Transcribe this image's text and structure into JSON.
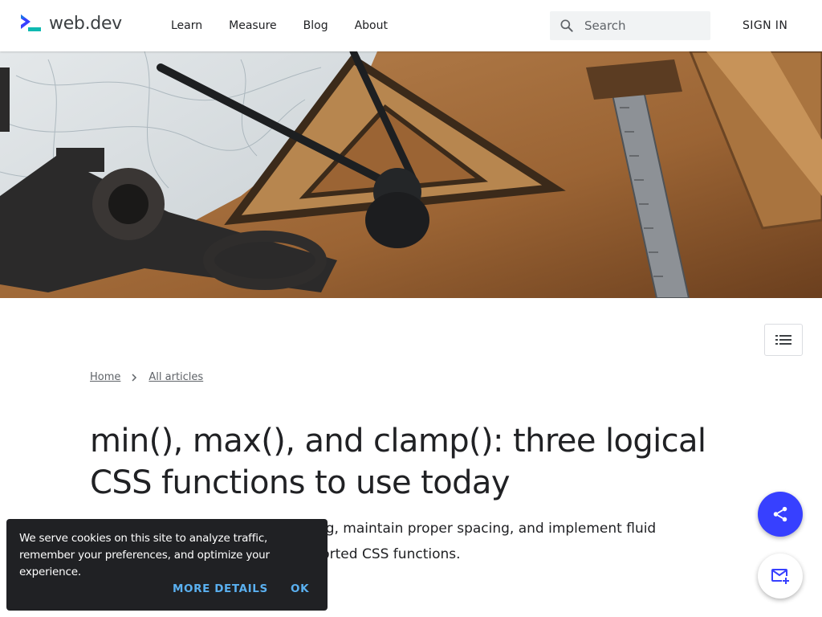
{
  "header": {
    "logo_text": "web.dev",
    "nav": [
      {
        "label": "Learn"
      },
      {
        "label": "Measure"
      },
      {
        "label": "Blog"
      },
      {
        "label": "About"
      }
    ],
    "search_placeholder": "Search",
    "signin_label": "SIGN IN"
  },
  "breadcrumb": {
    "home": "Home",
    "all_articles": "All articles"
  },
  "article": {
    "title": "min(), max(), and clamp(): three logical CSS functions to use today",
    "subtitle": "Learn how to control element sizing, maintain proper spacing, and implement fluid typography using these well-supported CSS functions."
  },
  "cookie_banner": {
    "text": "We serve cookies on this site to analyze traffic, remember your preferences, and optimize your experience.",
    "more_details_label": "MORE DETAILS",
    "ok_label": "OK"
  },
  "icons": {
    "search": "search-icon",
    "toc": "list-icon",
    "share": "share-icon",
    "subscribe": "mail-add-icon",
    "breadcrumb_separator": "chevron-right-icon"
  },
  "colors": {
    "accent": "#3740ff",
    "cookie_bg": "#202124",
    "cookie_link": "#5ab0f0",
    "text": "#202124"
  }
}
